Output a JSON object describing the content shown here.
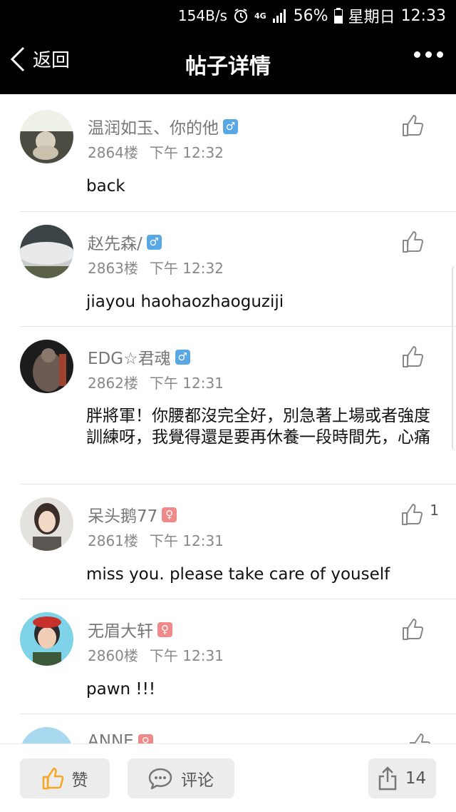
{
  "status_bar": {
    "speed": "154B/s",
    "network": "4G",
    "battery": "56%",
    "day": "星期日",
    "time": "12:33",
    "icons": [
      "alarm-icon",
      "network-4g-icon",
      "signal-icon",
      "battery-icon"
    ]
  },
  "nav": {
    "back_label": "返回",
    "title": "帖子详情",
    "more_icon": "more-icon"
  },
  "comments": [
    {
      "name": "温润如玉、你的他",
      "gender": "♂",
      "floor": "2864楼",
      "time": "下午 12:32",
      "text": "back",
      "likes": ""
    },
    {
      "name": "赵先森/",
      "gender": "♂",
      "floor": "2863楼",
      "time": "下午 12:32",
      "text": "jiayou haohaozhaoguziji",
      "likes": ""
    },
    {
      "name": "EDG☆君魂",
      "gender": "♂",
      "floor": "2862楼",
      "time": "下午 12:31",
      "text": "胖將軍！你腰都沒完全好，別急著上場或者強度訓練呀，我覺得還是要再休養一段時間先，心痛",
      "likes": ""
    },
    {
      "name": "呆头鹅77",
      "gender": "♀",
      "floor": "2861楼",
      "time": "下午 12:31",
      "text": "miss you. please take care of youself",
      "likes": "1"
    },
    {
      "name": "无眉大轩",
      "gender": "♀",
      "floor": "2860楼",
      "time": "下午 12:31",
      "text": "pawn !!!",
      "likes": ""
    },
    {
      "name": "ANNE",
      "gender": "♀",
      "floor": "",
      "time": "",
      "text": "",
      "likes": ""
    }
  ],
  "bottom_bar": {
    "like_label": "赞",
    "comment_label": "评论",
    "share_count": "14"
  },
  "colors": {
    "accent": "#f5a623",
    "male": "#59a8e6",
    "female": "#f08a8a"
  }
}
